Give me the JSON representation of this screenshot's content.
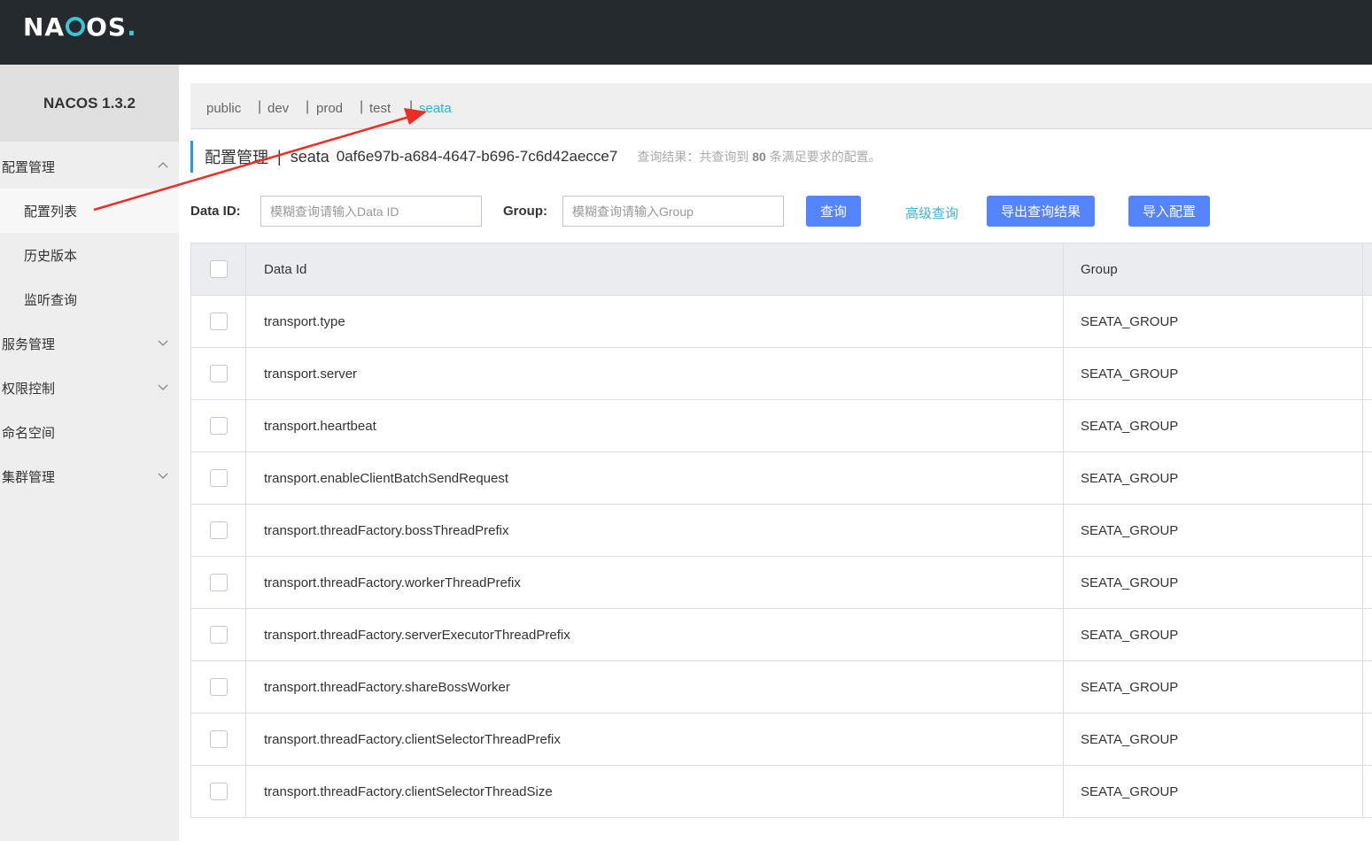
{
  "app": {
    "logo_text": "NACOS",
    "version": "NACOS 1.3.2"
  },
  "sidebar": {
    "items": [
      {
        "label": "配置管理",
        "type": "group",
        "chevron": "up"
      },
      {
        "label": "配置列表",
        "type": "sub",
        "active": true
      },
      {
        "label": "历史版本",
        "type": "sub"
      },
      {
        "label": "监听查询",
        "type": "sub"
      },
      {
        "label": "服务管理",
        "type": "group",
        "chevron": "down"
      },
      {
        "label": "权限控制",
        "type": "group",
        "chevron": "down"
      },
      {
        "label": "命名空间",
        "type": "group"
      },
      {
        "label": "集群管理",
        "type": "group",
        "chevron": "down"
      }
    ]
  },
  "namespaces": {
    "items": [
      "public",
      "dev",
      "prod",
      "test",
      "seata"
    ],
    "active": "seata",
    "separator": "|"
  },
  "title": {
    "main": "配置管理",
    "separator": "|",
    "namespace": "seata",
    "namespace_id": "0af6e97b-a684-4647-b696-7c6d42aecce7",
    "result_prefix": "查询结果：共查询到",
    "result_count": "80",
    "result_suffix": "条满足要求的配置。"
  },
  "search": {
    "data_id_label": "Data ID:",
    "data_id_placeholder": "模糊查询请输入Data ID",
    "group_label": "Group:",
    "group_placeholder": "模糊查询请输入Group",
    "query_button": "查询",
    "advanced_link": "高级查询",
    "export_button": "导出查询结果",
    "import_button": "导入配置"
  },
  "table": {
    "columns": [
      "Data Id",
      "Group"
    ],
    "rows": [
      {
        "data_id": "transport.type",
        "group": "SEATA_GROUP"
      },
      {
        "data_id": "transport.server",
        "group": "SEATA_GROUP"
      },
      {
        "data_id": "transport.heartbeat",
        "group": "SEATA_GROUP"
      },
      {
        "data_id": "transport.enableClientBatchSendRequest",
        "group": "SEATA_GROUP"
      },
      {
        "data_id": "transport.threadFactory.bossThreadPrefix",
        "group": "SEATA_GROUP"
      },
      {
        "data_id": "transport.threadFactory.workerThreadPrefix",
        "group": "SEATA_GROUP"
      },
      {
        "data_id": "transport.threadFactory.serverExecutorThreadPrefix",
        "group": "SEATA_GROUP"
      },
      {
        "data_id": "transport.threadFactory.shareBossWorker",
        "group": "SEATA_GROUP"
      },
      {
        "data_id": "transport.threadFactory.clientSelectorThreadPrefix",
        "group": "SEATA_GROUP"
      },
      {
        "data_id": "transport.threadFactory.clientSelectorThreadSize",
        "group": "SEATA_GROUP"
      }
    ]
  },
  "colors": {
    "accent": "#5584ff",
    "topbar": "#252a2f",
    "link": "#29b4d6",
    "annotation_arrow": "#ee2e24"
  }
}
